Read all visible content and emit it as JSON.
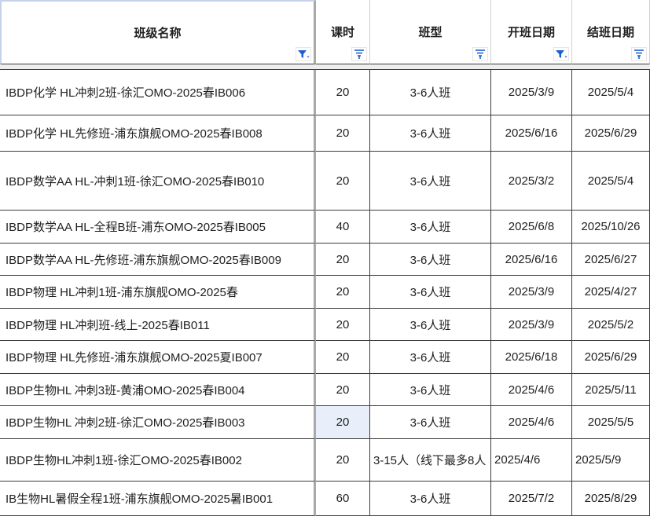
{
  "headers": {
    "name": "班级名称",
    "hours": "课时",
    "type": "班型",
    "start": "开班日期",
    "end": "结班日期"
  },
  "rows": [
    {
      "name": "IBDP化学 HL冲刺2班-徐汇OMO-2025春IB006",
      "hours": "20",
      "type": "3-6人班",
      "start": "2025/3/9",
      "end": "2025/5/4"
    },
    {
      "name": "IBDP化学 HL先修班-浦东旗舰OMO-2025春IB008",
      "hours": "20",
      "type": "3-6人班",
      "start": "2025/6/16",
      "end": "2025/6/29"
    },
    {
      "name": "IBDP数学AA HL-冲刺1班-徐汇OMO-2025春IB010",
      "hours": "20",
      "type": "3-6人班",
      "start": "2025/3/2",
      "end": "2025/5/4"
    },
    {
      "name": "IBDP数学AA HL-全程B班-浦东OMO-2025春IB005",
      "hours": "40",
      "type": "3-6人班",
      "start": "2025/6/8",
      "end": "2025/10/26"
    },
    {
      "name": "IBDP数学AA HL-先修班-浦东旗舰OMO-2025春IB009",
      "hours": "20",
      "type": "3-6人班",
      "start": "2025/6/16",
      "end": "2025/6/27"
    },
    {
      "name": "IBDP物理 HL冲刺1班-浦东旗舰OMO-2025春",
      "hours": "20",
      "type": "3-6人班",
      "start": "2025/3/9",
      "end": "2025/4/27"
    },
    {
      "name": "IBDP物理 HL冲刺班-线上-2025春IB011",
      "hours": "20",
      "type": "3-6人班",
      "start": "2025/3/9",
      "end": "2025/5/2"
    },
    {
      "name": "IBDP物理 HL先修班-浦东旗舰OMO-2025夏IB007",
      "hours": "20",
      "type": "3-6人班",
      "start": "2025/6/18",
      "end": "2025/6/29"
    },
    {
      "name": "IBDP生物HL 冲刺3班-黄浦OMO-2025春IB004",
      "hours": "20",
      "type": "3-6人班",
      "start": "2025/4/6",
      "end": "2025/5/11"
    },
    {
      "name": "IBDP生物HL 冲刺2班-徐汇OMO-2025春IB003",
      "hours": "20",
      "type": "3-6人班",
      "start": "2025/4/6",
      "end": "2025/5/5"
    },
    {
      "name": "IBDP生物HL冲刺1班-徐汇OMO-2025春IB002",
      "hours": "20",
      "type": "3-15人（线下最多8人",
      "start": "2025/4/6",
      "end": "2025/5/9"
    },
    {
      "name": "IB生物HL暑假全程1班-浦东旗舰OMO-2025暑IB001",
      "hours": "60",
      "type": "3-6人班",
      "start": "2025/7/2",
      "end": "2025/8/29"
    }
  ],
  "filter_state": {
    "name": "active",
    "hours": "inactive",
    "type": "inactive",
    "start": "active",
    "end": "inactive"
  },
  "colors": {
    "filter_active": "#1a5fd1",
    "filter_inactive": "#1a5fd1",
    "selected_cell": "#e8effb"
  }
}
